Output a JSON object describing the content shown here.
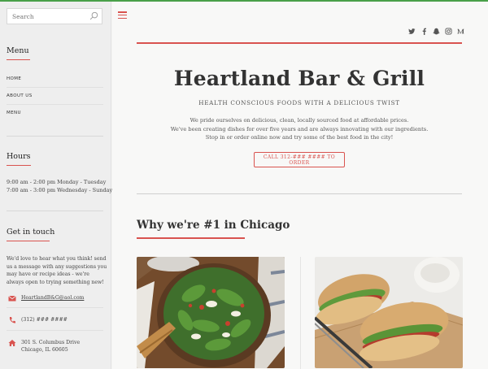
{
  "search": {
    "placeholder": "Search"
  },
  "sidebar": {
    "menu_heading": "Menu",
    "menu_items": [
      "HOME",
      "ABOUT US",
      "MENU"
    ],
    "hours_heading": "Hours",
    "hours": [
      "9:00 am - 2:00 pm Monday - Tuesday",
      "7:00 am - 3:00 pm Wednesday - Sunday"
    ],
    "touch_heading": "Get in touch",
    "touch_text": "We'd love to hear what you think! send us a message with any suggestions you may have or recipe ideas - we're always open to trying something new!",
    "email": "HeartlandB&G@aol.com",
    "phone": "(312) ### ####",
    "address_line1": "301 S. Columbus Drive",
    "address_line2": "Chicago, IL 60605"
  },
  "social_icons": [
    "twitter-icon",
    "facebook-icon",
    "snapchat-icon",
    "instagram-icon",
    "medium-icon"
  ],
  "hero": {
    "title": "Heartland Bar & Grill",
    "subtitle": "HEALTH CONSCIOUS FOODS WITH A DELICIOUS TWIST",
    "desc1": "We pride ourselves on delicious, clean, locally sourced food at affordable prices.",
    "desc2": "We've been creating dishes for over five years and are always innovating with our ingredients.",
    "desc3": "Stop in or order online now and try some of the best food in the city!",
    "cta": "CALL 312-### #### TO ORDER"
  },
  "section": {
    "title": "Why we're #1 in Chicago"
  },
  "colors": {
    "accent": "#d9534f",
    "top_bar": "#49a049",
    "sidebar_bg": "#eeeeee"
  }
}
